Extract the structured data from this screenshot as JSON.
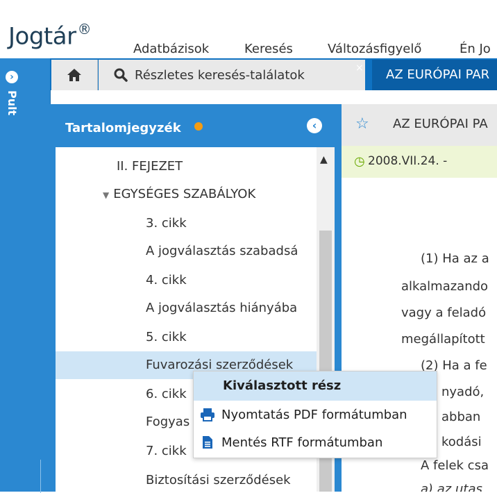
{
  "header": {
    "logo": "Jogtár",
    "logo_mark": "®",
    "nav": [
      "Adatbázisok",
      "Keresés",
      "Változásfigyelő",
      "Én Jo"
    ]
  },
  "pult": {
    "label": "Pult"
  },
  "tabs": {
    "home_icon": "home-icon",
    "search_tab_label": "Részletes keresés-találatok",
    "close_symbol": "×",
    "active_tab_label": "AZ EURÓPAI PAR"
  },
  "toc": {
    "title": "Tartalomjegyzék",
    "items": [
      "II. FEJEZET",
      "EGYSÉGES SZABÁLYOK",
      "3. cikk",
      "A jogválasztás szabadsá",
      "4. cikk",
      "A jogválasztás hiányába",
      "5. cikk",
      "Fuvarozási szerződések",
      "6. cikk",
      "Fogyas",
      "7. cikk",
      "Biztosítási szerződések"
    ],
    "selected_index": 7
  },
  "document": {
    "title": "AZ EURÓPAI PA",
    "date": "2008.VII.24. -",
    "lines": [
      "(1) Ha az a",
      "alkalmazando",
      "vagy a feladó",
      "megállapított",
      "(2) Ha a fe",
      "nyadó,",
      "abban",
      "kodási",
      "A felek csa",
      "a) az utas"
    ]
  },
  "context_menu": {
    "title": "Kiválasztott rész",
    "items": [
      {
        "icon": "printer-icon",
        "label": "Nyomtatás PDF formátumban"
      },
      {
        "icon": "document-icon",
        "label": "Mentés RTF formátumban"
      }
    ]
  },
  "colors": {
    "accent_blue": "#2b88d1",
    "tab_blue": "#0f72c2",
    "highlight": "#cfe5f6",
    "orange_dot": "#f39c12"
  }
}
